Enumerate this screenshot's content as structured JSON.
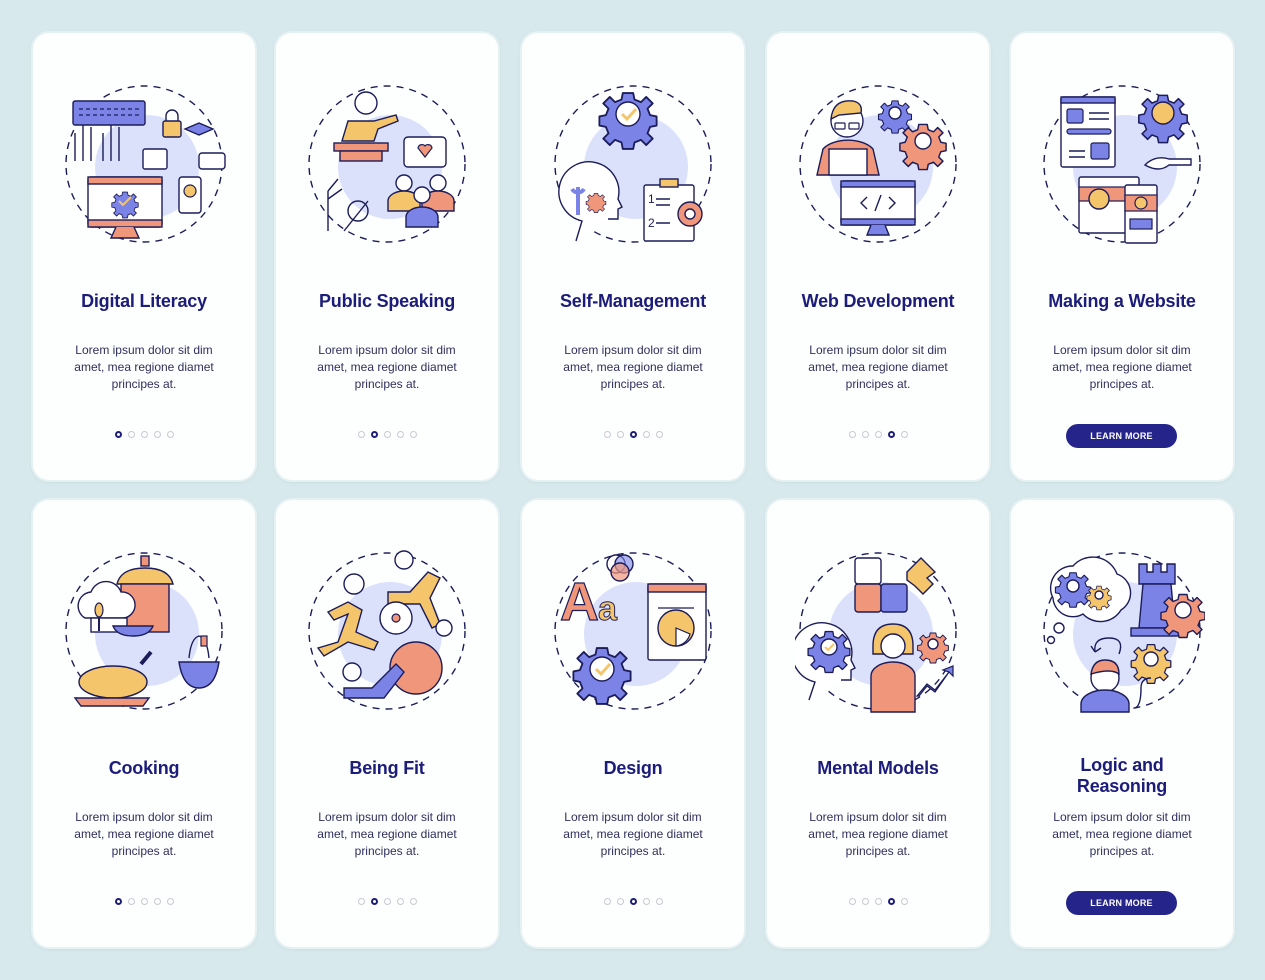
{
  "colors": {
    "background": "#d8e9ed",
    "card": "#fdfefe",
    "title": "#1c1c7a",
    "button": "#24248a",
    "accent_purple": "#7b84e6",
    "accent_orange": "#f0977b",
    "accent_yellow": "#f5c56b",
    "halo": "#dbe1fb"
  },
  "cards": [
    {
      "title": "Digital Literacy",
      "description": "Lorem ipsum dolor sit dim amet, mea regione diamet principes at.",
      "illustration": "digital-literacy-illustration",
      "page_index": 1,
      "page_count": 5
    },
    {
      "title": "Public Speaking",
      "description": "Lorem ipsum dolor sit dim amet, mea regione diamet principes at.",
      "illustration": "public-speaking-illustration",
      "page_index": 2,
      "page_count": 5
    },
    {
      "title": "Self-Management",
      "description": "Lorem ipsum dolor sit dim amet, mea regione diamet principes at.",
      "illustration": "self-management-illustration",
      "page_index": 3,
      "page_count": 5
    },
    {
      "title": "Web Development",
      "description": "Lorem ipsum dolor sit dim amet, mea regione diamet principes at.",
      "illustration": "web-development-illustration",
      "page_index": 4,
      "page_count": 5
    },
    {
      "title": "Making a Website",
      "description": "Lorem ipsum dolor sit dim amet, mea regione diamet principes at.",
      "illustration": "making-a-website-illustration",
      "button_label": "LEARN MORE"
    },
    {
      "title": "Cooking",
      "description": "Lorem ipsum dolor sit dim amet, mea regione diamet principes at.",
      "illustration": "cooking-illustration",
      "page_index": 1,
      "page_count": 5
    },
    {
      "title": "Being Fit",
      "description": "Lorem ipsum dolor sit dim amet, mea regione diamet principes at.",
      "illustration": "being-fit-illustration",
      "page_index": 2,
      "page_count": 5
    },
    {
      "title": "Design",
      "description": "Lorem ipsum dolor sit dim amet, mea regione diamet principes at.",
      "illustration": "design-illustration",
      "page_index": 3,
      "page_count": 5
    },
    {
      "title": "Mental Models",
      "description": "Lorem ipsum dolor sit dim amet, mea regione diamet principes at.",
      "illustration": "mental-models-illustration",
      "page_index": 4,
      "page_count": 5
    },
    {
      "title": "Logic and Reasoning",
      "description": "Lorem ipsum dolor sit dim amet, mea regione diamet principes at.",
      "illustration": "logic-and-reasoning-illustration",
      "button_label": "LEARN MORE"
    }
  ]
}
